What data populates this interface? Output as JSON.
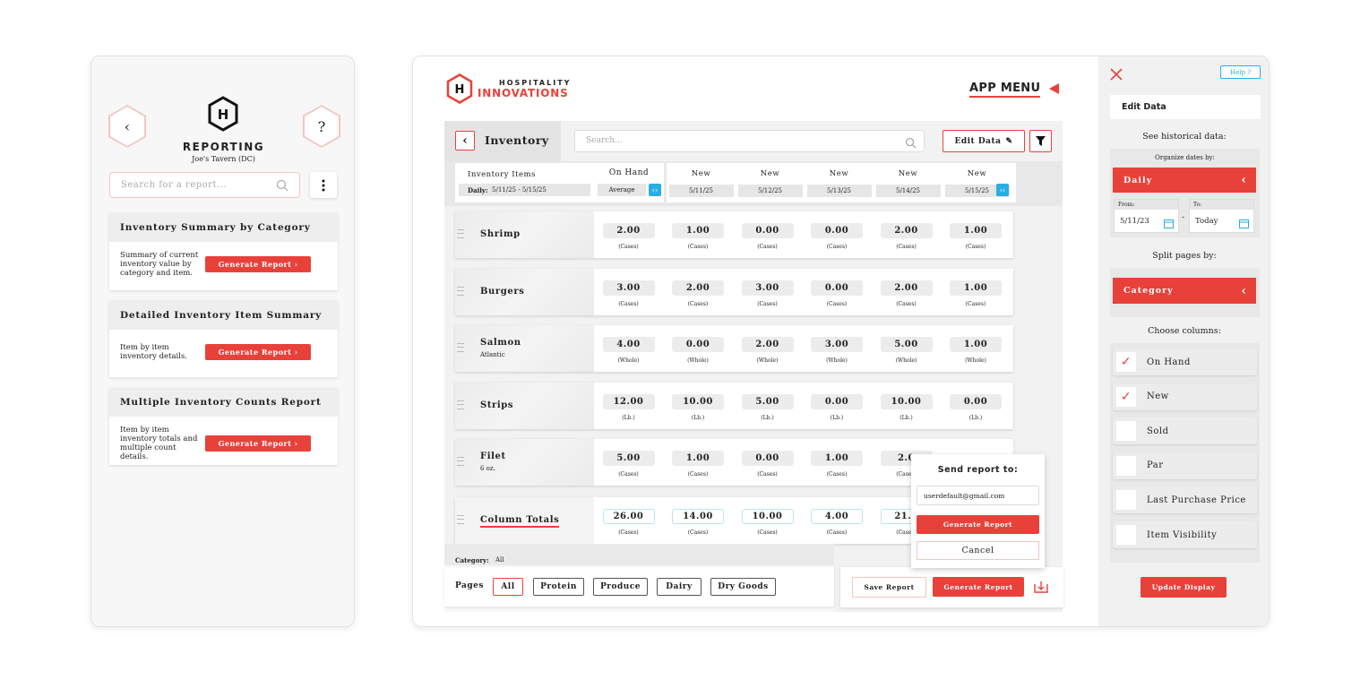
{
  "mobile": {
    "title": "REPORTING",
    "subtitle": "Joe's Tavern (DC)",
    "back_icon": "chevron-left-icon",
    "help_label": "?",
    "search_placeholder": "Search for a report...",
    "more_icon": "vertical-dots-icon",
    "reports": [
      {
        "title": "Inventory Summary by Category",
        "description": "Summary of current inventory value by category and item.",
        "button": "Generate Report  ›"
      },
      {
        "title": "Detailed Inventory Item Summary",
        "description": "Item by item inventory details.",
        "button": "Generate Report  ›"
      },
      {
        "title": "Multiple Inventory Counts Report",
        "description": "Item by item inventory totals and multiple count details.",
        "button": "Generate Report  ›"
      }
    ]
  },
  "brand": {
    "line1": "HOSPITALITY",
    "line2": "INNOVATIONS"
  },
  "app_menu": "APP MENU",
  "toolbar": {
    "title": "Inventory",
    "search_placeholder": "Search...",
    "edit_data": "Edit Data"
  },
  "columns": {
    "items_header": "Inventory Items",
    "date_range_label": "Daily:",
    "date_range": "5/11/25 - 5/15/25",
    "onhand_header": "On Hand",
    "onhand_sub": "Average",
    "dates": [
      {
        "header": "New",
        "date": "5/11/25"
      },
      {
        "header": "New",
        "date": "5/12/25"
      },
      {
        "header": "New",
        "date": "5/13/25"
      },
      {
        "header": "New",
        "date": "5/14/25"
      },
      {
        "header": "New",
        "date": "5/15/25"
      }
    ]
  },
  "rows": [
    {
      "name": "Shrimp",
      "sub": "",
      "values": [
        "2.00",
        "1.00",
        "0.00",
        "0.00",
        "2.00",
        "1.00"
      ],
      "unit": "(Cases)"
    },
    {
      "name": "Burgers",
      "sub": "",
      "values": [
        "3.00",
        "2.00",
        "3.00",
        "0.00",
        "2.00",
        "1.00"
      ],
      "unit": "(Cases)"
    },
    {
      "name": "Salmon",
      "sub": "Atlantic",
      "values": [
        "4.00",
        "0.00",
        "2.00",
        "3.00",
        "5.00",
        "1.00"
      ],
      "unit": "(Whole)"
    },
    {
      "name": "Strips",
      "sub": "",
      "values": [
        "12.00",
        "10.00",
        "5.00",
        "0.00",
        "10.00",
        "0.00"
      ],
      "unit": "(Lb.)"
    },
    {
      "name": "Filet",
      "sub": "6 oz.",
      "values": [
        "5.00",
        "1.00",
        "0.00",
        "1.00",
        "2.0",
        ""
      ],
      "unit": "(Cases)"
    }
  ],
  "totals": {
    "name": "Column Totals",
    "values": [
      "26.00",
      "14.00",
      "10.00",
      "4.00",
      "21.0"
    ],
    "unit": "(Cases)"
  },
  "pages": {
    "category_label": "Category:",
    "category_value": "All",
    "label": "Pages",
    "tabs": [
      "All",
      "Protein",
      "Produce",
      "Dairy",
      "Dry Goods"
    ]
  },
  "actions": {
    "save": "Save Report",
    "generate": "Generate Report"
  },
  "send_popup": {
    "title": "Send report to:",
    "email": "userdefault@gmail.com",
    "generate": "Generate Report",
    "cancel": "Cancel"
  },
  "side": {
    "help": "Help ?",
    "edit_data": "Edit Data",
    "historical": "See historical data:",
    "organize": "Organize dates by:",
    "organize_value": "Daily",
    "from_label": "From:",
    "from_value": "5/11/23",
    "to_label": "To:",
    "to_value": "Today",
    "split": "Split pages by:",
    "split_value": "Category",
    "choose": "Choose columns:",
    "columns": [
      {
        "label": "On Hand",
        "checked": true
      },
      {
        "label": "New",
        "checked": true
      },
      {
        "label": "Sold",
        "checked": false
      },
      {
        "label": "Par",
        "checked": false
      },
      {
        "label": "Last Purchase Price",
        "checked": false
      },
      {
        "label": "Item Visibility",
        "checked": false
      }
    ],
    "update": "Update Display"
  },
  "colors": {
    "accent": "#e8413a",
    "cyan": "#29aee4"
  }
}
